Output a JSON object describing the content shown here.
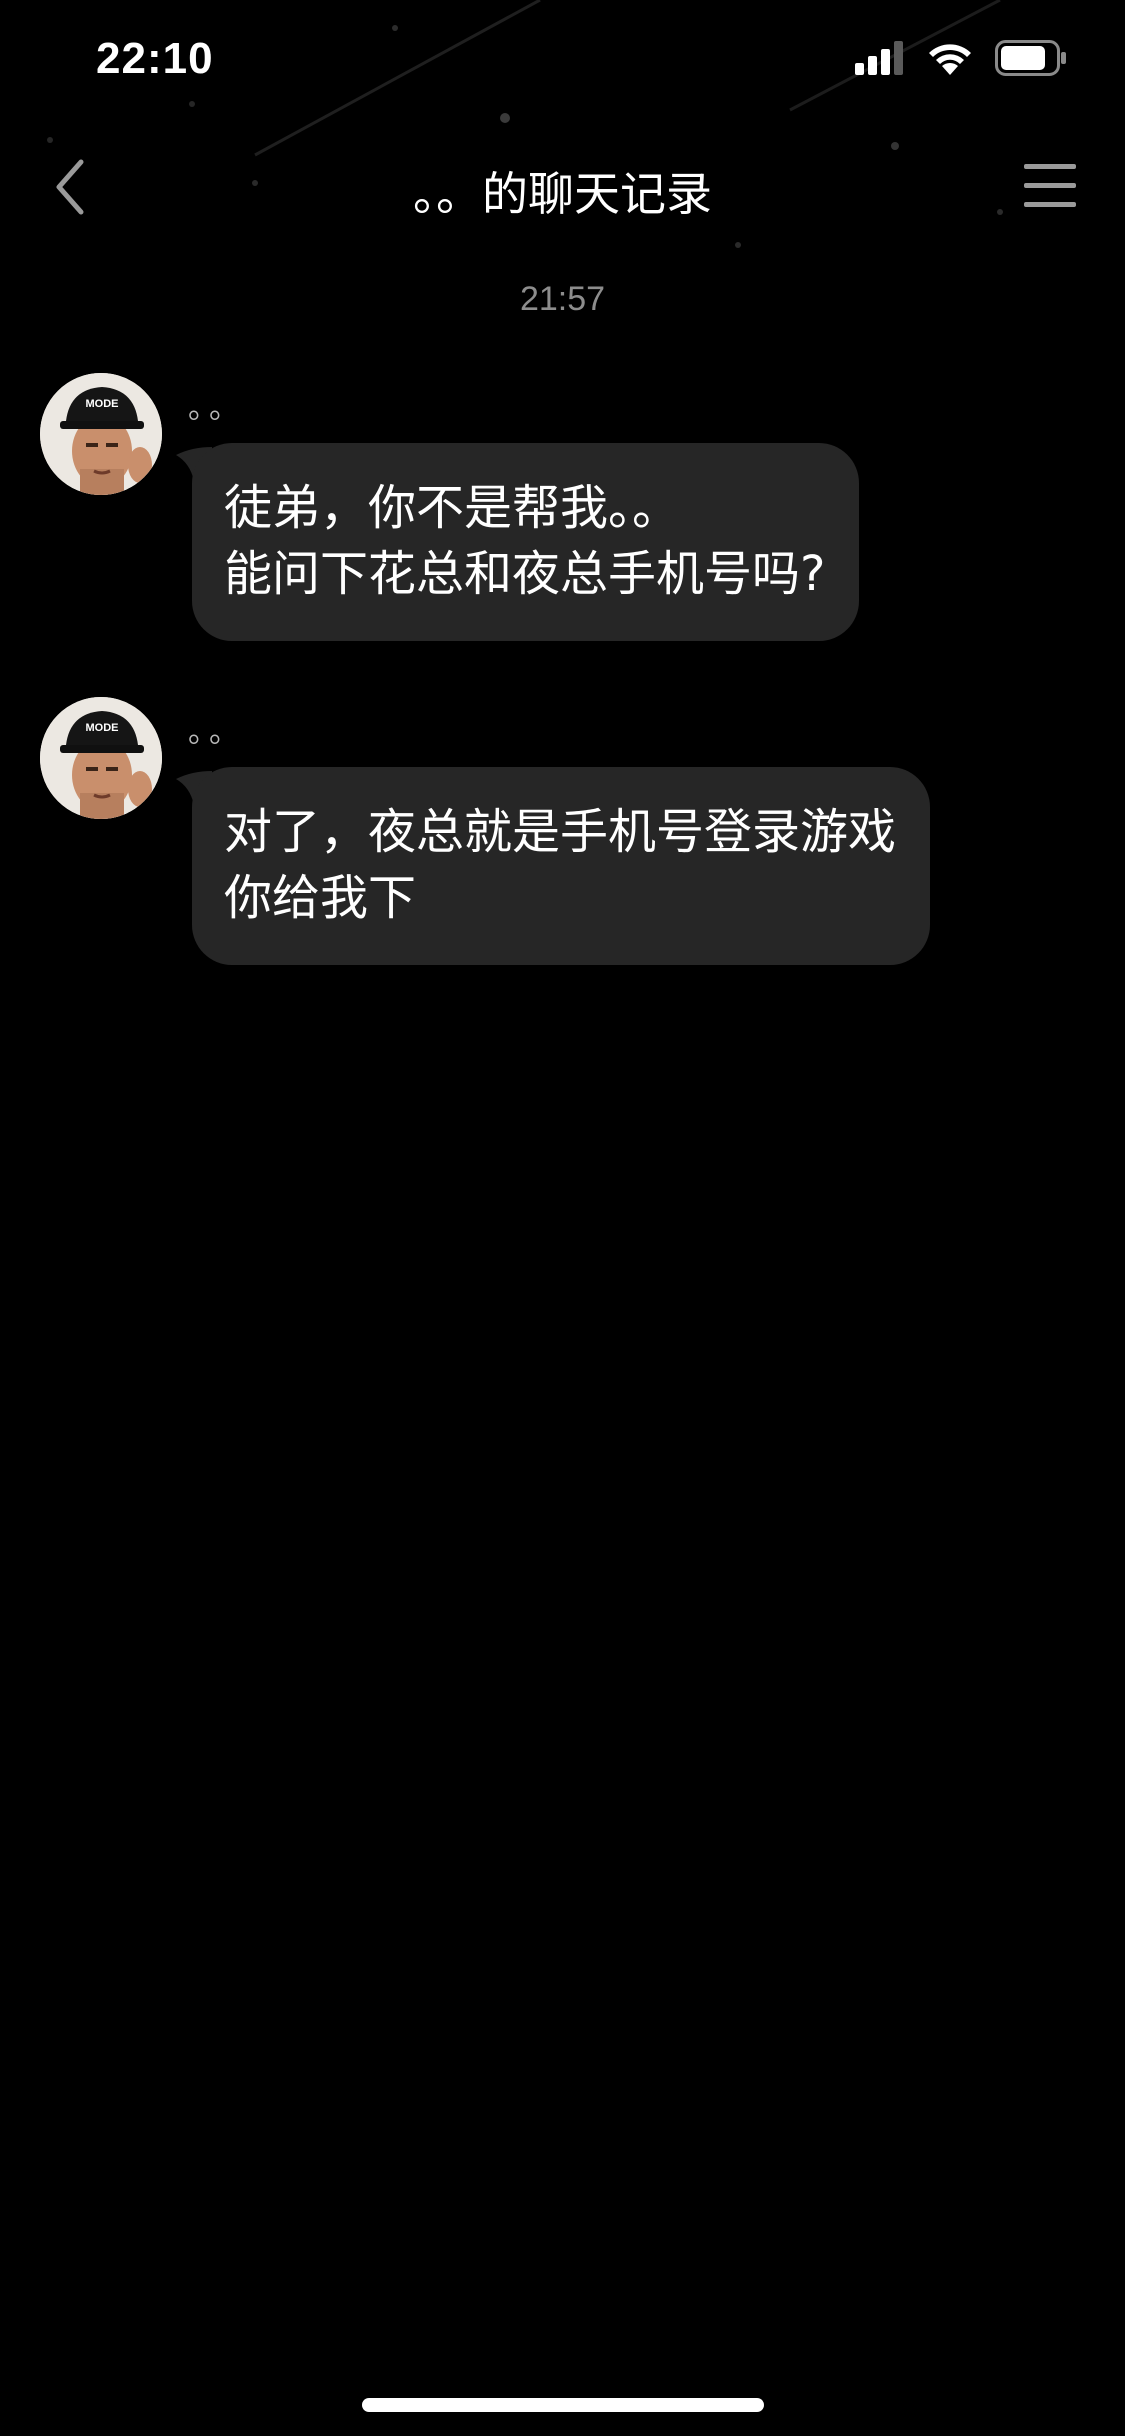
{
  "status_bar": {
    "time": "22:10"
  },
  "nav": {
    "title": "。。的聊天记录",
    "back_icon": "chevron-left-icon",
    "menu_icon": "hamburger-menu-icon"
  },
  "timestamp": "21:57",
  "messages": [
    {
      "sender": "。。",
      "text": "徒弟，你不是帮我。。\n能问下花总和夜总手机号吗?"
    },
    {
      "sender": "。。",
      "text": "对了，夜总就是手机号登录游戏\n你给我下"
    }
  ],
  "colors": {
    "background": "#000000",
    "bubble": "#262626",
    "timestamp": "#8d8d8d"
  }
}
